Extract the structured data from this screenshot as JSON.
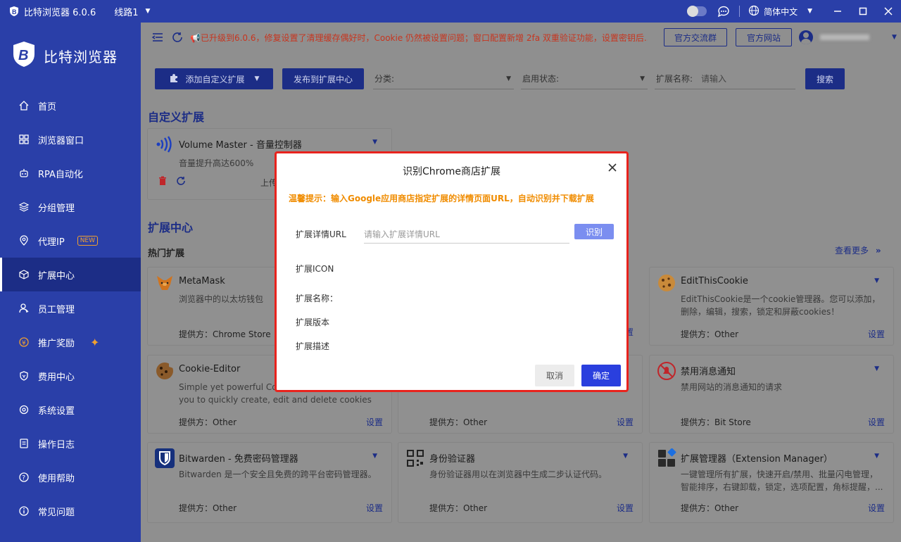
{
  "titlebar": {
    "app_name": "比特浏览器 6.0.6",
    "route": "线路1",
    "language": "简体中文"
  },
  "sidebar": {
    "brand": "比特浏览器",
    "items": [
      {
        "label": "首页",
        "icon": "home-icon"
      },
      {
        "label": "浏览器窗口",
        "icon": "grid-icon"
      },
      {
        "label": "RPA自动化",
        "icon": "robot-icon"
      },
      {
        "label": "分组管理",
        "icon": "layers-icon"
      },
      {
        "label": "代理IP",
        "icon": "location-icon",
        "badge": "NEW"
      },
      {
        "label": "扩展中心",
        "icon": "cube-icon",
        "active": true
      },
      {
        "label": "员工管理",
        "icon": "user-icon"
      },
      {
        "label": "推广奖励",
        "icon": "reward-icon"
      },
      {
        "label": "费用中心",
        "icon": "shield-icon"
      },
      {
        "label": "系统设置",
        "icon": "gear-icon"
      },
      {
        "label": "操作日志",
        "icon": "log-icon"
      },
      {
        "label": "使用帮助",
        "icon": "help-icon"
      },
      {
        "label": "常见问题",
        "icon": "info-icon"
      }
    ]
  },
  "topbar": {
    "notice": "📢已升级到6.0.6，修复设置了清理缓存偶好时，Cookie 仍然被设置问题；窗口配置新增 2fa 双重验证功能，设置密钥后...",
    "community_button": "官方交流群",
    "website_button": "官方网站"
  },
  "filters": {
    "add_custom_button": "添加自定义扩展",
    "publish_button": "发布到扩展中心",
    "category_label": "分类:",
    "status_label": "启用状态:",
    "name_label": "扩展名称:",
    "name_placeholder": "请输入",
    "search_button": "搜索"
  },
  "custom_section": {
    "title": "自定义扩展",
    "card": {
      "name": "Volume Master - 音量控制器",
      "desc": "音量提升高达600%",
      "partial_text": "上传"
    }
  },
  "center_section": {
    "title": "扩展中心",
    "hot_title": "热门扩展",
    "see_more": "查看更多",
    "cards": [
      {
        "name": "MetaMask",
        "desc": "浏览器中的以太坊钱包",
        "provider": "提供方：Chrome Store",
        "setting": "",
        "icon": "fox-icon",
        "color": "#b8762a"
      },
      {
        "name": "EditThisCookie",
        "desc": "EditThisCookie是一个cookie管理器。您可以添加，删除，编辑，搜索，锁定和屏蔽cookies！",
        "provider": "提供方：Other",
        "setting": "设置",
        "icon": "cookie-icon",
        "color": "#9a6a2a"
      },
      {
        "name": "Cookie-Editor",
        "desc": "Simple yet powerful Cookie Editor that allow you to quickly create, edit and delete cookies without leaving your tab.",
        "provider": "提供方：Other",
        "setting": "设置",
        "icon": "cookie-icon",
        "color": "#6a4a2a"
      },
      {
        "name": "",
        "desc": "",
        "provider": "提供方：Other",
        "setting": "设置",
        "icon": "",
        "color": ""
      },
      {
        "name": "禁用消息通知",
        "desc": "禁用网站的消息通知的请求",
        "provider": "提供方：Bit Store",
        "setting": "设置",
        "icon": "bell-off-icon",
        "color": "#c0262a"
      },
      {
        "name": "Bitwarden - 免费密码管理器",
        "desc": "Bitwarden 是一个安全且免费的跨平台密码管理器。",
        "provider": "提供方：Other",
        "setting": "设置",
        "icon": "bitwarden-shield-icon",
        "color": "#16307c"
      },
      {
        "name": "身份验证器",
        "desc": "身份验证器用以在浏览器中生成二步认证代码。",
        "provider": "提供方：Other",
        "setting": "设置",
        "icon": "qr-icon",
        "color": "#333333"
      },
      {
        "name": "扩展管理器（Extension Manager）",
        "desc": "一键管理所有扩展，快速开启/禁用、批量闪电管理，智能排序，右键卸载，锁定，选项配置，角标提醒，...",
        "provider": "提供方：Other",
        "setting": "设置",
        "icon": "puzzle-grid-icon",
        "color": "#2a2a2a"
      }
    ],
    "middle_partial_setting": "置"
  },
  "modal": {
    "title": "识别Chrome商店扩展",
    "tip": "温馨提示：输入Google应用商店指定扩展的详情页面URL，自动识别并下载扩展",
    "url_label": "扩展详情URL",
    "url_placeholder": "请输入扩展详情URL",
    "url_value": "",
    "identify_button": "识别",
    "icon_label": "扩展ICON",
    "name_label": "扩展名称：",
    "version_label": "扩展版本",
    "desc_label": "扩展描述",
    "cancel_button": "取消",
    "ok_button": "确定"
  },
  "colors": {
    "primary": "#2a3fa8",
    "dark_primary": "#1c2d86",
    "modal_border": "#e8231d",
    "tip": "#f08c00",
    "ok": "#2a3fde"
  }
}
